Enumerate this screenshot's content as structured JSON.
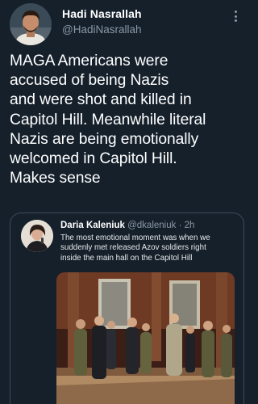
{
  "tweet": {
    "author_name": "Hadi Nasrallah",
    "author_handle": "@HadiNasrallah",
    "text_lines": [
      "MAGA Americans were",
      "accused of being Nazis",
      "and were shot and killed in",
      "Capitol Hill. Meanwhile literal",
      "Nazis are being emotionally",
      "welcomed in Capitol Hill.",
      "Makes sense"
    ]
  },
  "quoted_tweet": {
    "author_name": "Daria Kaleniuk",
    "author_handle": "@dkaleniuk",
    "separator": " · ",
    "time": "2h",
    "text_lines": [
      "The most emotional moment was when we",
      "suddenly met released Azov soldiers right",
      "inside the main hall on the Capitol Hill"
    ]
  },
  "icons": {
    "more": "more-vertical-icon"
  },
  "colors": {
    "background": "#15202b",
    "primary_text": "#ffffff",
    "secondary_text": "#8b98a5",
    "quote_border": "#3d4a57"
  }
}
